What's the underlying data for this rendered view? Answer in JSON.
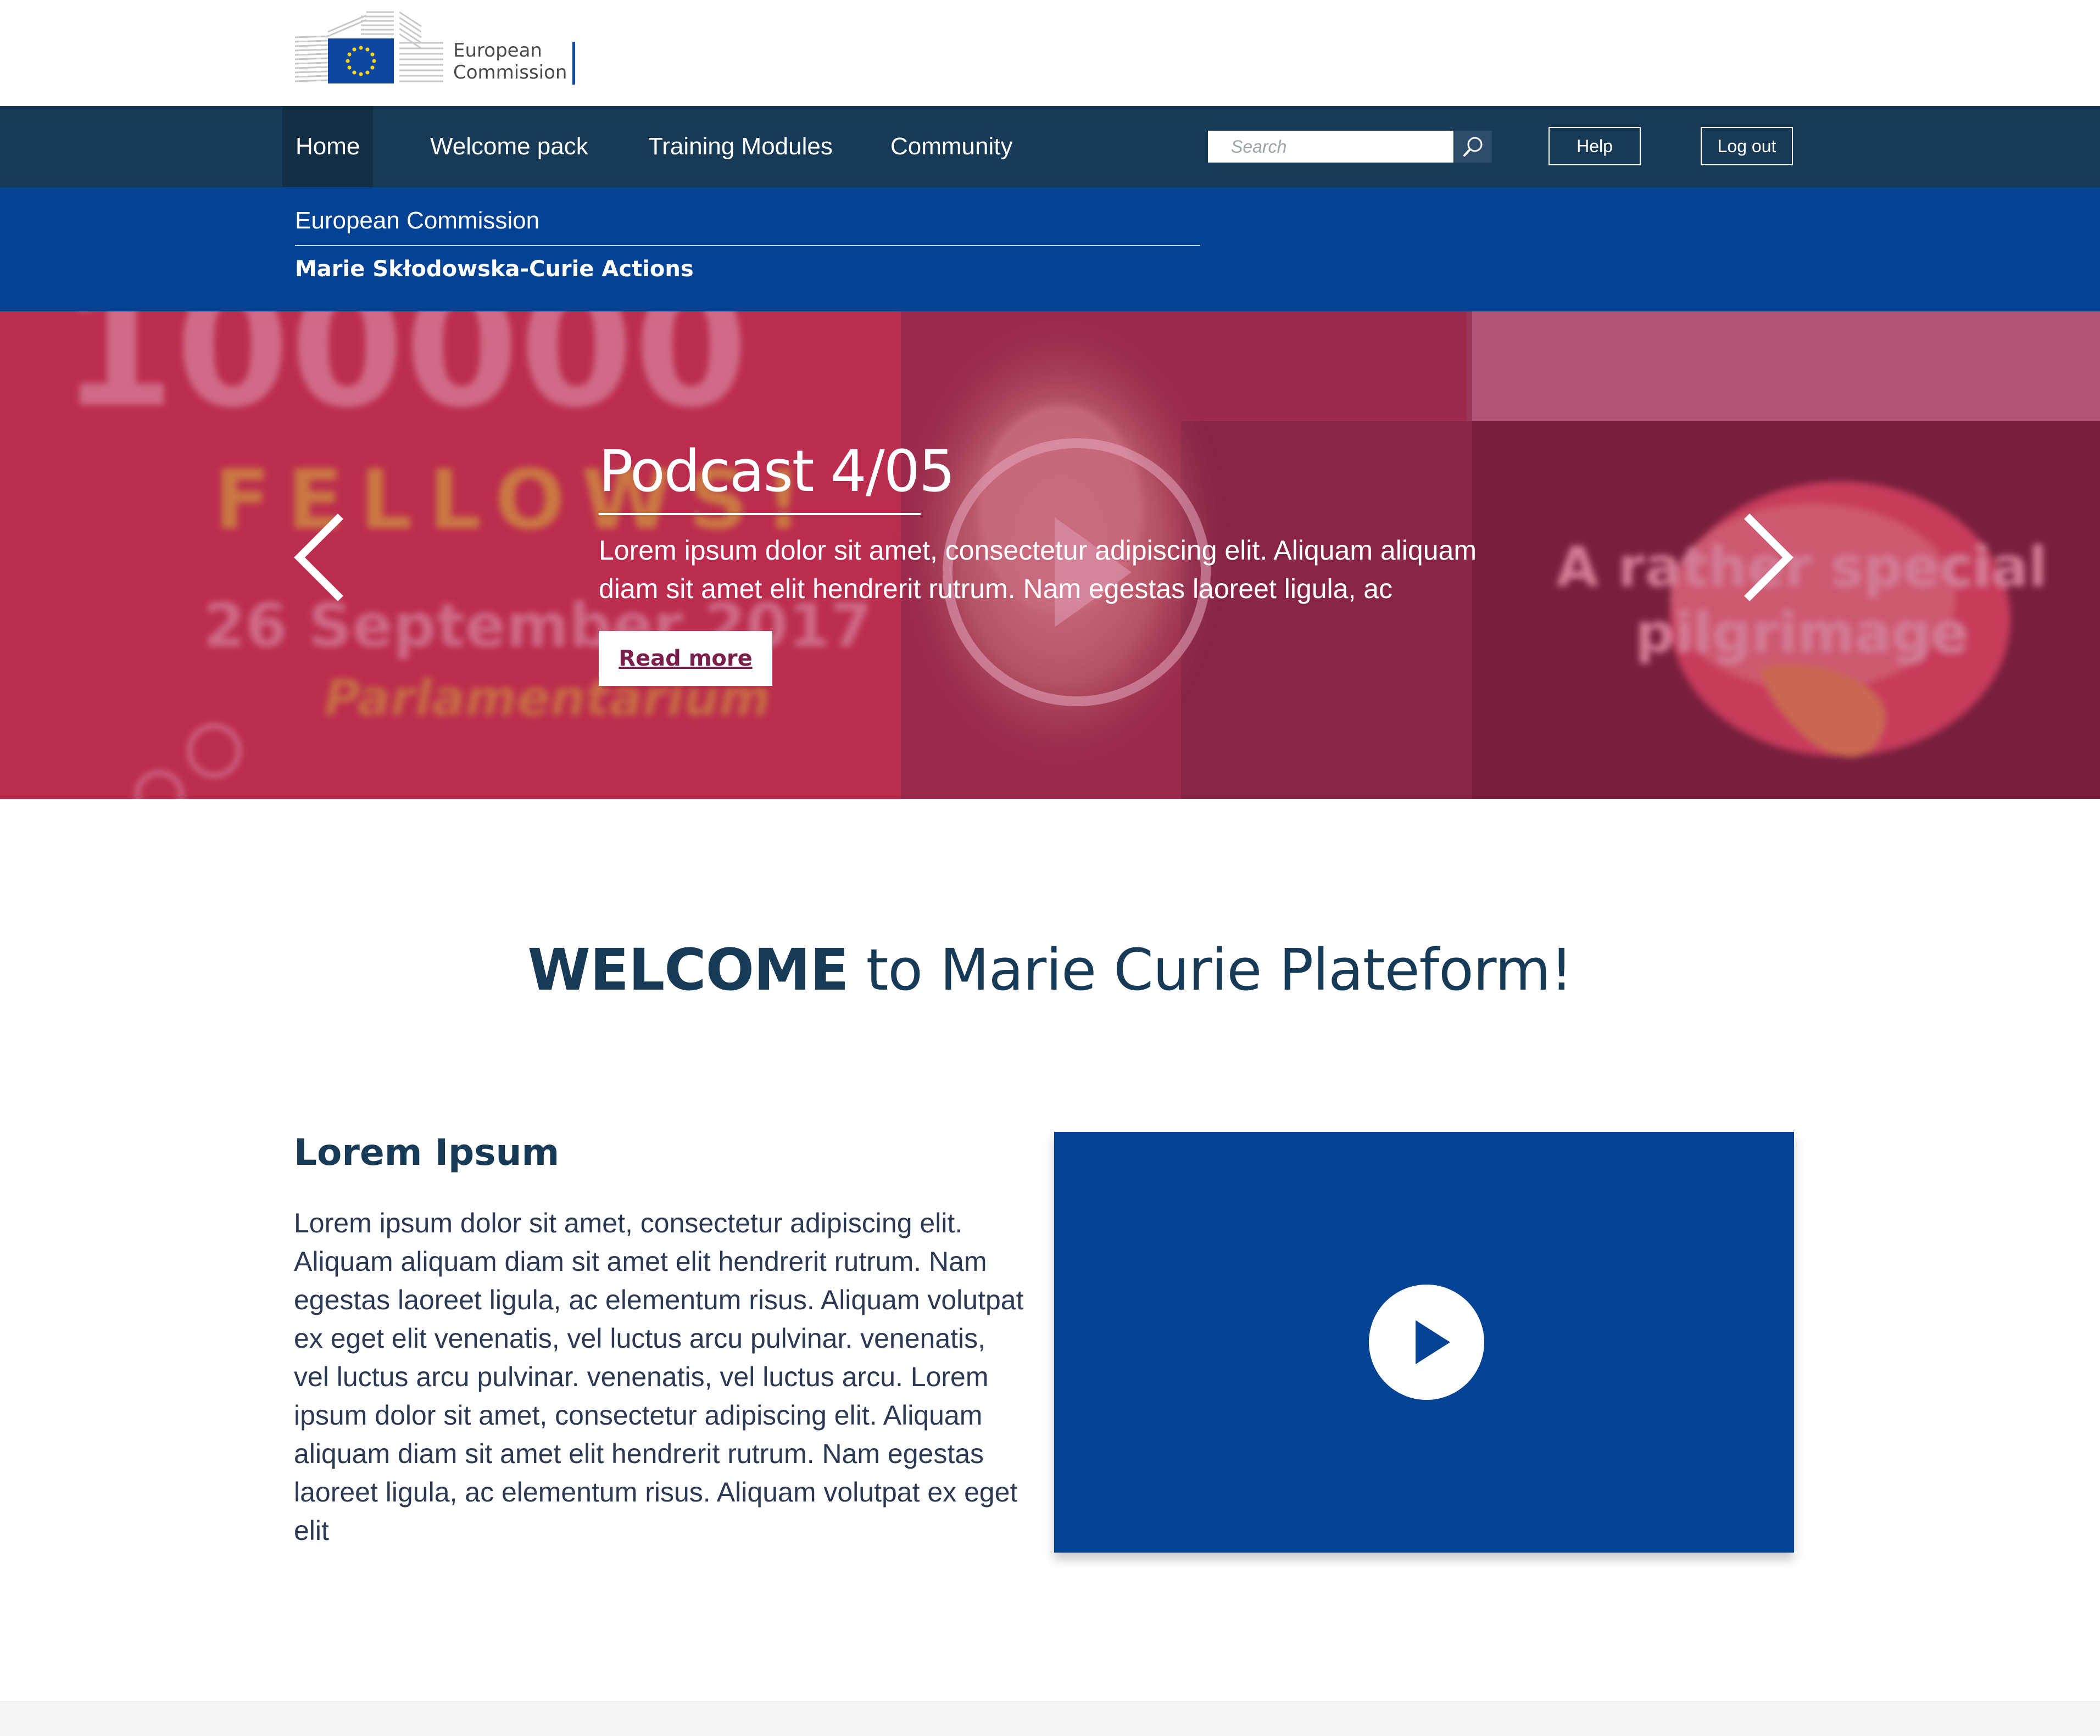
{
  "logo": {
    "line1": "European",
    "line2": "Commission"
  },
  "nav": {
    "items": [
      {
        "label": "Home",
        "active": true
      },
      {
        "label": "Welcome pack",
        "active": false
      },
      {
        "label": "Training Modules",
        "active": false
      },
      {
        "label": "Community",
        "active": false
      }
    ],
    "search_placeholder": "Search",
    "help_label": "Help",
    "logout_label": "Log out"
  },
  "band": {
    "top": "European Commission",
    "bottom": "Marie Skłodowska-Curie Actions"
  },
  "hero": {
    "title": "Podcast 4/05",
    "text": "Lorem ipsum dolor sit amet, consectetur adipiscing elit. Aliquam aliquam diam sit amet elit hendrerit rutrum. Nam egestas laoreet ligula, ac",
    "read_more": "Read more",
    "bg_text_big": "100000",
    "bg_text_fellows": "FELLOWS!",
    "bg_text_date": "26 September 2017",
    "bg_text_venue": "Parlamentarium",
    "bg_text_right1": "A rather special",
    "bg_text_right2": "pilgrimage",
    "overlay_color": "#b0274d"
  },
  "welcome": {
    "bold": "WELCOME",
    "rest": " to Marie Curie Plateform!"
  },
  "content": {
    "title": "Lorem Ipsum",
    "text": "Lorem ipsum dolor sit amet, consectetur adipiscing elit. Aliquam aliquam diam sit amet elit hendrerit rutrum. Nam egestas laoreet ligula, ac elementum risus. Aliquam volutpat ex eget elit venenatis, vel luctus arcu pulvinar. venenatis, vel luctus arcu pulvinar.  venenatis, vel luctus arcu. Lorem ipsum dolor sit amet, consectetur adipiscing elit. Aliquam aliquam diam sit amet elit hendrerit rutrum. Nam egestas laoreet ligula, ac elementum risus. Aliquam volutpat ex eget elit"
  },
  "colors": {
    "nav": "#173a56",
    "band": "#044394",
    "video": "#044394",
    "accent": "#7a1f4b"
  }
}
